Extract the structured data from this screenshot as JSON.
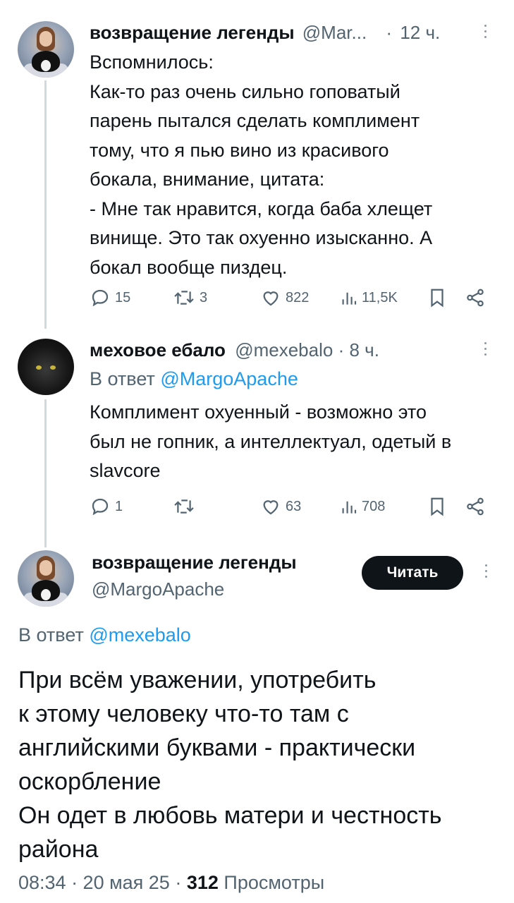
{
  "tweets": [
    {
      "name": "возвращение легенды",
      "handle": "@Mar...",
      "time": "12 ч.",
      "text_lines": [
        "Вспомнилось:",
        "Как-то раз очень сильно гоповатый",
        "парень пытался сделать комплимент",
        "тому, что я пью вино из красивого",
        "бокала, внимание, цитата:",
        "- Мне так нравится, когда баба хлещет",
        "винище. Это так охуенно изысканно. А",
        "бокал вообще пиздец."
      ],
      "stats": {
        "replies": "15",
        "reposts": "3",
        "likes": "822",
        "views": "11,5K"
      },
      "icons": [
        "reply-icon",
        "repost-icon",
        "like-icon",
        "views-icon",
        "bookmark-icon",
        "share-icon"
      ]
    },
    {
      "name": "меховое ебало",
      "handle": "@mexebalo",
      "time": "8 ч.",
      "reply_prefix": "В ответ",
      "reply_handle": "@MargoApache",
      "text_lines": [
        "Комплимент охуенный - возможно это",
        "был не гопник, а интеллектуал, одетый в",
        "slavcore"
      ],
      "stats": {
        "replies": "1",
        "reposts": "",
        "likes": "63",
        "views": "708"
      }
    }
  ],
  "main_tweet": {
    "name": "возвращение легенды",
    "handle": "@MargoApache",
    "follow_label": "Читать",
    "reply_prefix": "В ответ",
    "reply_handle": "@mexebalo",
    "text_lines": [
      "При всём уважении, употребить",
      "к этому человеку что-то там с",
      "английскими буквами - практически",
      "оскорбление",
      "Он одет в любовь матери и честность",
      "района"
    ],
    "time": "08:34 · 20 мая 25 ·",
    "views_count": "312",
    "views_label": "Просмотры"
  },
  "colors": {
    "text": "#0f1419",
    "secondary": "#536471",
    "link": "#1d9bf0",
    "thread_line": "#cfd9de"
  }
}
